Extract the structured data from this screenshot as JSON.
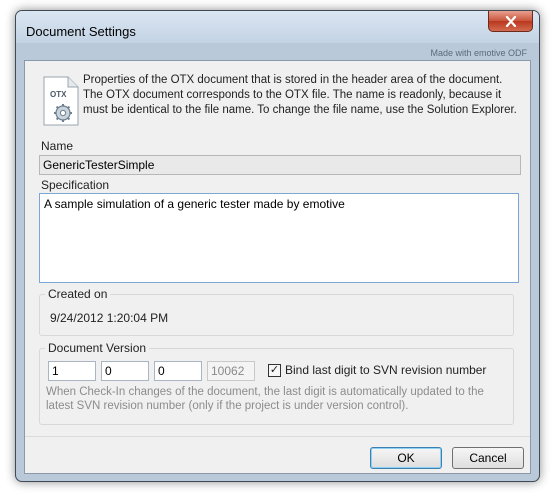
{
  "window": {
    "title": "Document Settings",
    "watermark": "Made with emotive ODF",
    "close_icon": "close-icon"
  },
  "info": {
    "icon": "otx-document-icon",
    "icon_label": "OTX",
    "text": "Properties of the OTX document that is stored in the header area of the document. The OTX document corresponds to the OTX file. The name is readonly, because it must be identical to the file name. To change the file name, use the Solution Explorer."
  },
  "name": {
    "label": "Name",
    "value": "GenericTesterSimple"
  },
  "specification": {
    "label": "Specification",
    "value": "A sample simulation of a generic tester made by emotive"
  },
  "created": {
    "label": "Created on",
    "value": "9/24/2012 1:20:04 PM"
  },
  "version": {
    "label": "Document Version",
    "major": "1",
    "minor": "0",
    "build": "0",
    "revision": "10062",
    "bind_checked": true,
    "bind_label": "Bind last digit to SVN revision number",
    "note": "When Check-In changes of the document, the last digit is automatically updated to the latest SVN revision number (only if the project is under version control)."
  },
  "buttons": {
    "ok": "OK",
    "cancel": "Cancel"
  },
  "colors": {
    "frame": "#b9c9da",
    "close_button": "#c8533a",
    "focus_border": "#7aa7d6"
  }
}
